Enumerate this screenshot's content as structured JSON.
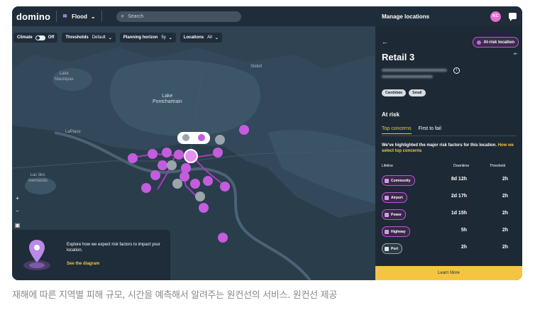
{
  "app": {
    "logo": "domino",
    "hazard": "Flood",
    "search_placeholder": "Search"
  },
  "filters": {
    "climate": {
      "label": "Climate",
      "value": "Off"
    },
    "thresholds": {
      "label": "Thresholds",
      "value": "Default"
    },
    "horizon": {
      "label": "Planning horizon",
      "value": "5y"
    },
    "locations": {
      "label": "Locations",
      "value": "All"
    }
  },
  "map": {
    "lake_label": "Lake\nPontchartrain",
    "maurepas": "Lake\nMaurepas",
    "lac": "Lac des\nAllemands",
    "slidell": "Slidell",
    "laplace": "LaPlace",
    "zoom_in": "+",
    "zoom_out": "−"
  },
  "promo": {
    "text": "Explore how we expect risk factors to impact your location.",
    "link": "See the diagram"
  },
  "panel": {
    "header": "Manage locations",
    "avatar": "KC",
    "at_risk_badge": "At-risk location",
    "title": "Retail 3",
    "tags": [
      "Candidate",
      "Small"
    ],
    "section": "At risk",
    "tabs": [
      "Top concerns",
      "First to fail"
    ],
    "desc": "We've highlighted the major risk factors for this location. ",
    "desc_link": "How we select top concerns",
    "cols": {
      "lifeline": "Lifeline",
      "downtime": "Downtime",
      "threshold": "Threshold"
    },
    "rows": [
      {
        "name": "Community",
        "downtime": "8d 12h",
        "threshold": "2h",
        "at_risk": true
      },
      {
        "name": "Airport",
        "downtime": "2d 17h",
        "threshold": "2h",
        "at_risk": true
      },
      {
        "name": "Power",
        "downtime": "1d 15h",
        "threshold": "2h",
        "at_risk": true
      },
      {
        "name": "Highway",
        "downtime": "5h",
        "threshold": "2h",
        "at_risk": true
      },
      {
        "name": "Port",
        "downtime": "2h",
        "threshold": "2h",
        "at_risk": false
      }
    ],
    "learn_more": "Learn More"
  },
  "caption": "재해에 따른 지역별 피해 규모, 시간을 예측해서 알려주는 원컨선의 서비스. 원컨선 제공"
}
